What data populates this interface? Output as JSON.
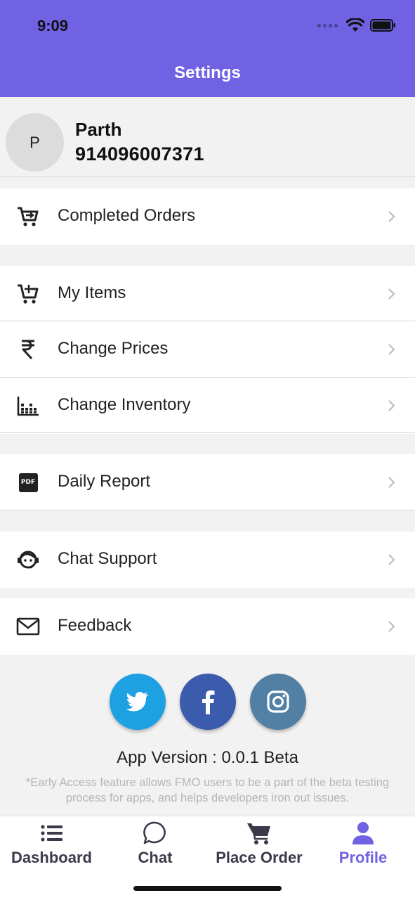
{
  "status_bar": {
    "time": "9:09"
  },
  "header": {
    "title": "Settings"
  },
  "profile": {
    "avatar_initial": "P",
    "name": "Parth",
    "phone": "914096007371"
  },
  "menu": {
    "completed_orders": {
      "label": "Completed Orders",
      "icon": "cart-arrow-icon"
    },
    "my_items": {
      "label": "My Items",
      "icon": "cart-plus-icon"
    },
    "change_prices": {
      "label": "Change Prices",
      "icon": "rupee-icon"
    },
    "change_inventory": {
      "label": "Change Inventory",
      "icon": "inventory-chart-icon"
    },
    "daily_report": {
      "label": "Daily Report",
      "icon": "pdf-icon",
      "icon_text": "PDF"
    },
    "chat_support": {
      "label": "Chat Support",
      "icon": "support-agent-icon"
    },
    "feedback": {
      "label": "Feedback",
      "icon": "envelope-icon"
    }
  },
  "social": {
    "twitter": {
      "icon": "twitter-icon",
      "color": "#1da1e2"
    },
    "facebook": {
      "icon": "facebook-icon",
      "color": "#3b5cad"
    },
    "instagram": {
      "icon": "instagram-icon",
      "color": "#527fa4"
    }
  },
  "footer": {
    "version": "App Version : 0.0.1 Beta",
    "note": "*Early Access feature allows FMO users to be a part of the beta testing process for apps, and helps developers iron out issues."
  },
  "tabs": [
    {
      "label": "Dashboard",
      "icon": "list-icon",
      "active": false
    },
    {
      "label": "Chat",
      "icon": "chat-bubble-icon",
      "active": false
    },
    {
      "label": "Place Order",
      "icon": "cart-icon",
      "active": false
    },
    {
      "label": "Profile",
      "icon": "person-icon",
      "active": true
    }
  ],
  "colors": {
    "accent": "#7062e3",
    "background": "#f2f2f2",
    "row": "#ffffff",
    "muted_text": "#b5b5b5"
  }
}
